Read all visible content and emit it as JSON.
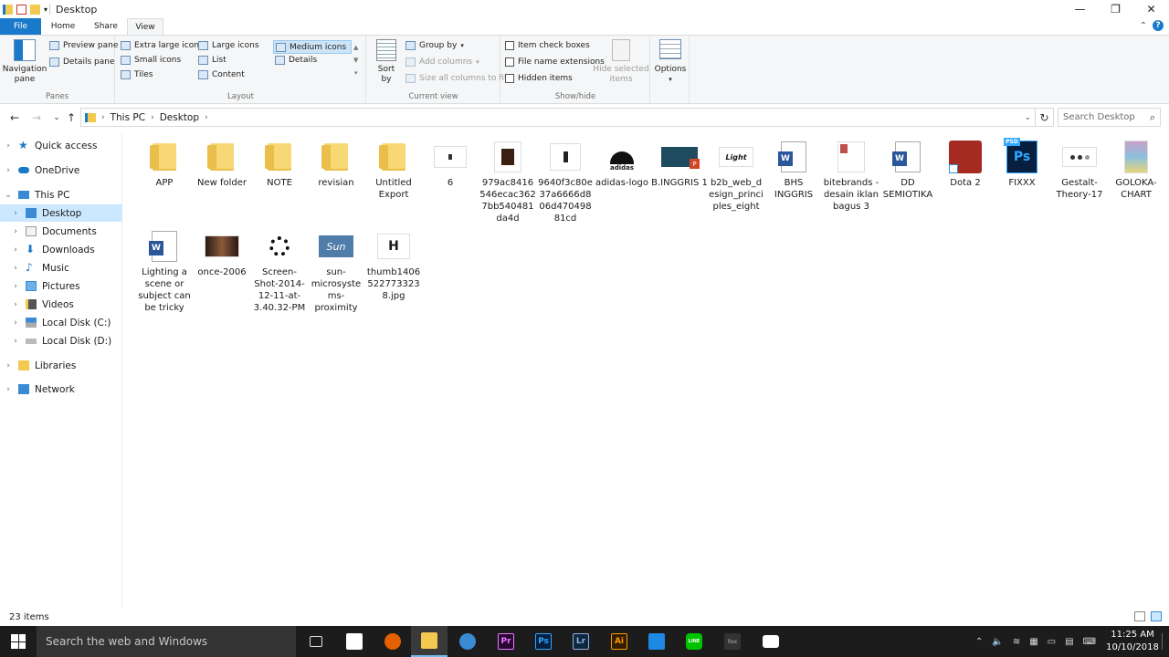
{
  "window": {
    "title": "Desktop"
  },
  "ribbon_tabs": [
    "File",
    "Home",
    "Share",
    "View"
  ],
  "ribbon": {
    "panes": {
      "nav_pane": "Navigation\npane",
      "preview": "Preview pane",
      "details": "Details pane",
      "label": "Panes"
    },
    "layout": {
      "xl": "Extra large icons",
      "large": "Large icons",
      "medium": "Medium icons",
      "small": "Small icons",
      "list": "List",
      "details": "Details",
      "tiles": "Tiles",
      "content": "Content",
      "label": "Layout"
    },
    "current_view": {
      "sort": "Sort\nby",
      "group": "Group by",
      "add_cols": "Add columns",
      "size_cols": "Size all columns to fit",
      "label": "Current view"
    },
    "show_hide": {
      "item_cb": "Item check boxes",
      "ext": "File name extensions",
      "hidden": "Hidden items",
      "hide_sel": "Hide selected\nitems",
      "label": "Show/hide"
    },
    "options": "Options"
  },
  "address": {
    "crumbs": [
      "This PC",
      "Desktop"
    ],
    "search_placeholder": "Search Desktop"
  },
  "nav": {
    "quick_access": "Quick access",
    "onedrive": "OneDrive",
    "this_pc": "This PC",
    "desktop": "Desktop",
    "documents": "Documents",
    "downloads": "Downloads",
    "music": "Music",
    "pictures": "Pictures",
    "videos": "Videos",
    "disk_c": "Local Disk (C:)",
    "disk_d": "Local Disk (D:)",
    "libraries": "Libraries",
    "network": "Network"
  },
  "files": [
    "APP",
    "New folder",
    "NOTE",
    "revisian",
    "Untitled Export",
    "6",
    "979ac8416546ecac3627bb540481da4d",
    "9640f3c80e37a6666d806d47049881cd",
    "adidas-logo",
    "B.INGGRIS 1",
    "b2b_web_design_principles_eight",
    "BHS INGGRIS",
    "bitebrands - desain iklan bagus 3",
    "DD SEMIOTIKA",
    "Dota 2",
    "FIXXX",
    "Gestalt-Theory-17",
    "GOLOKA-CHART",
    "Lighting a scene or subject can be tricky",
    "once-2006",
    "Screen-Shot-2014-12-11-at-3.40.32-PM",
    "sun-microsystems-proximity",
    "thumb14065227733238.jpg"
  ],
  "status": {
    "count": "23 items"
  },
  "taskbar": {
    "search": "Search the web and Windows",
    "time": "11:25 AM",
    "date": "10/10/2018"
  },
  "icons": {
    "adidas_text": "adidas",
    "ppt_badge": "P",
    "b2b_text": "Light",
    "word_badge": "W",
    "psd_tag": "PSD",
    "psd_letters": "Ps",
    "sun_text": "Sun",
    "thumb_letter": "H",
    "taskbar_pr": "Pr",
    "taskbar_ps": "Ps",
    "taskbar_lr": "Lr",
    "taskbar_ai": "Ai",
    "taskbar_line": "LINE",
    "taskbar_fox": "fox"
  }
}
